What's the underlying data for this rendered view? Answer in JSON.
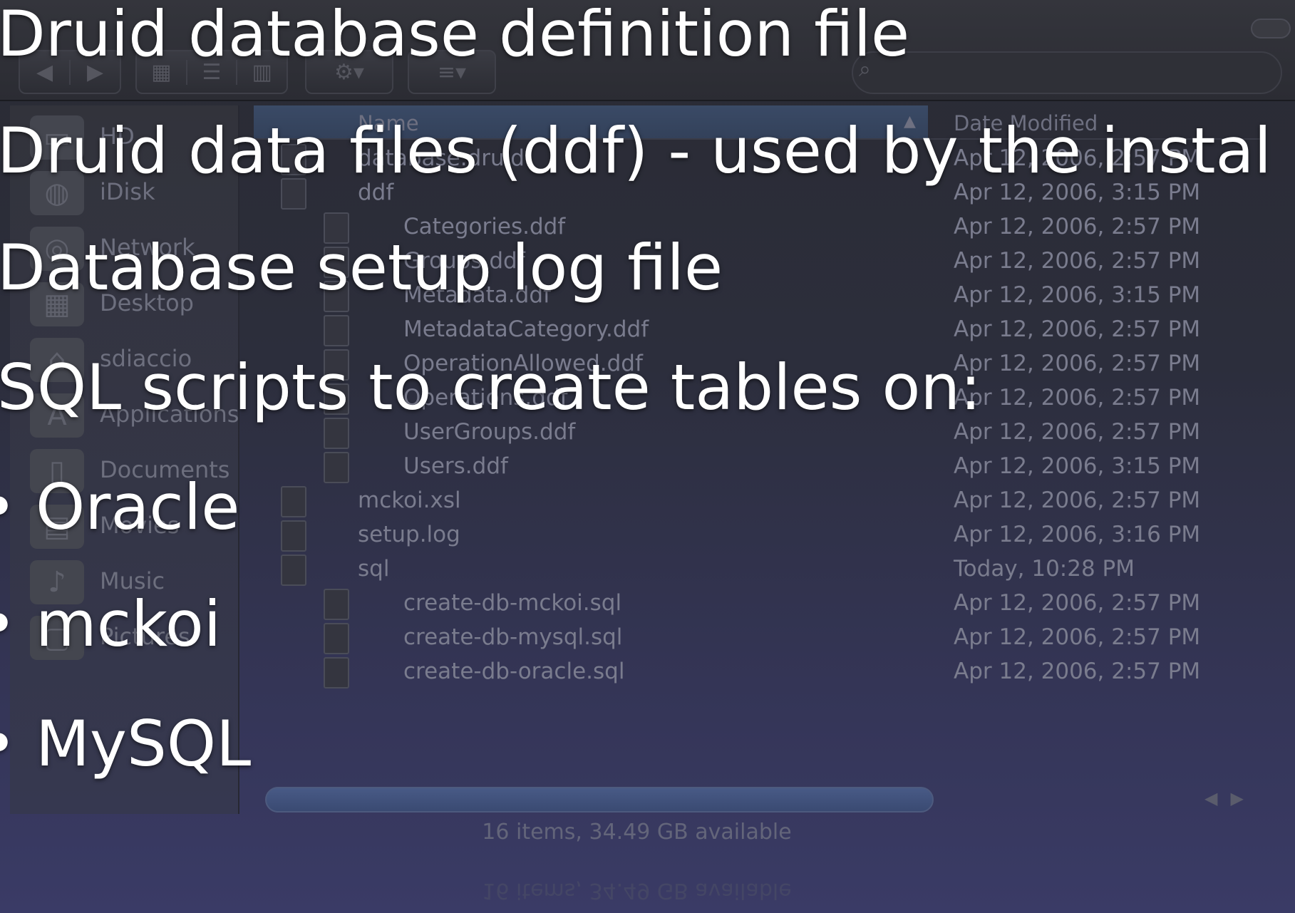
{
  "finder": {
    "columns": {
      "name": "Name",
      "date": "Date Modified"
    },
    "sidebar": [
      {
        "label": "HD",
        "icon": "hard-drive-icon"
      },
      {
        "label": "iDisk",
        "icon": "idisk-icon"
      },
      {
        "label": "Network",
        "icon": "network-globe-icon"
      },
      {
        "label": "Desktop",
        "icon": "desktop-icon"
      },
      {
        "label": "sdiaccio",
        "icon": "home-icon"
      },
      {
        "label": "Applications",
        "icon": "applications-icon"
      },
      {
        "label": "Documents",
        "icon": "documents-icon"
      },
      {
        "label": "Movies",
        "icon": "movies-icon"
      },
      {
        "label": "Music",
        "icon": "music-icon"
      },
      {
        "label": "Pictures",
        "icon": "pictures-icon"
      }
    ],
    "files": [
      {
        "name": "database.druid",
        "date": "Apr 12, 2006, 2:57 PM",
        "indent": 0
      },
      {
        "name": "ddf",
        "date": "Apr 12, 2006, 3:15 PM",
        "indent": 0
      },
      {
        "name": "Categories.ddf",
        "date": "Apr 12, 2006, 2:57 PM",
        "indent": 1
      },
      {
        "name": "Groups.ddf",
        "date": "Apr 12, 2006, 2:57 PM",
        "indent": 1
      },
      {
        "name": "Metadata.ddf",
        "date": "Apr 12, 2006, 3:15 PM",
        "indent": 1
      },
      {
        "name": "MetadataCategory.ddf",
        "date": "Apr 12, 2006, 2:57 PM",
        "indent": 1
      },
      {
        "name": "OperationAllowed.ddf",
        "date": "Apr 12, 2006, 2:57 PM",
        "indent": 1
      },
      {
        "name": "Operations.ddf",
        "date": "Apr 12, 2006, 2:57 PM",
        "indent": 1
      },
      {
        "name": "UserGroups.ddf",
        "date": "Apr 12, 2006, 2:57 PM",
        "indent": 1
      },
      {
        "name": "Users.ddf",
        "date": "Apr 12, 2006, 3:15 PM",
        "indent": 1
      },
      {
        "name": "mckoi.xsl",
        "date": "Apr 12, 2006, 2:57 PM",
        "indent": 0
      },
      {
        "name": "setup.log",
        "date": "Apr 12, 2006, 3:16 PM",
        "indent": 0
      },
      {
        "name": "sql",
        "date": "Today, 10:28 PM",
        "indent": 0
      },
      {
        "name": "create-db-mckoi.sql",
        "date": "Apr 12, 2006, 2:57 PM",
        "indent": 1
      },
      {
        "name": "create-db-mysql.sql",
        "date": "Apr 12, 2006, 2:57 PM",
        "indent": 1
      },
      {
        "name": "create-db-oracle.sql",
        "date": "Apr 12, 2006, 2:57 PM",
        "indent": 1
      }
    ],
    "status": "16 items, 34.49 GB available"
  },
  "slide": {
    "lines": [
      "Druid database definition file",
      "Druid data files (ddf) - used by the instal",
      "Database setup log file",
      "SQL scripts to create tables on:"
    ],
    "bullet_char": "•",
    "bullets": [
      "Oracle",
      "mckoi",
      "MySQL"
    ]
  }
}
